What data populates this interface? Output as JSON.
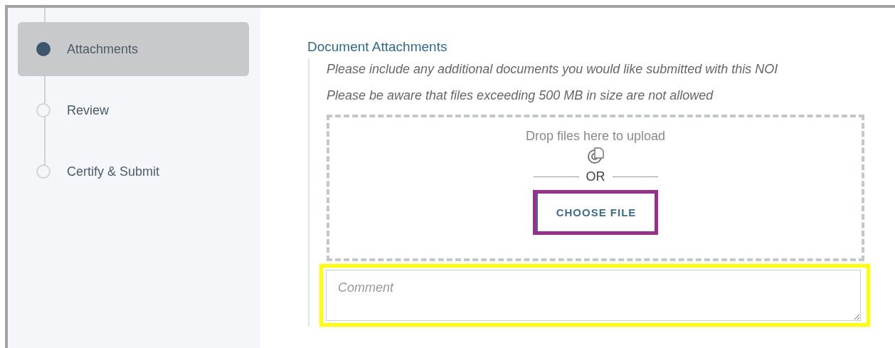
{
  "steps": [
    {
      "label": "Attachments",
      "selected": true
    },
    {
      "label": "Review",
      "selected": false
    },
    {
      "label": "Certify & Submit",
      "selected": false
    }
  ],
  "section": {
    "title": "Document Attachments",
    "notes": [
      "Please include any additional documents you would like submitted with this NOI",
      "Please be aware that files exceeding 500 MB in size are not allowed"
    ],
    "dropzone": {
      "prompt": "Drop files here to upload",
      "or_label": "OR",
      "button": {
        "label": "CHOOSE FILE",
        "highlighted": true
      }
    },
    "comment": {
      "placeholder": "Comment",
      "highlighted": true
    }
  }
}
